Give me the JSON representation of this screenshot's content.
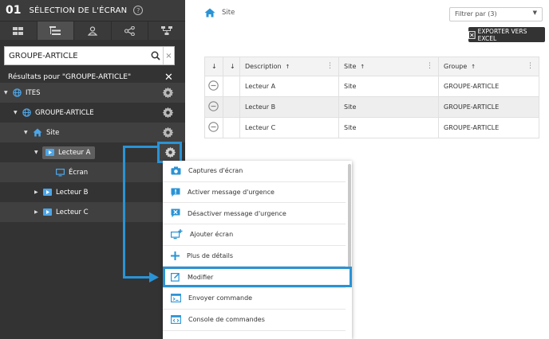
{
  "panel": {
    "step_number": "01",
    "title": "SÉLECTION DE L'ÉCRAN",
    "help": "?",
    "toolbar": [
      "grid-view-icon",
      "tree-view-icon",
      "user-tree-icon",
      "share-icon",
      "hierarchy-icon"
    ]
  },
  "search": {
    "value": "GROUPE-ARTICLE",
    "clear": "×"
  },
  "results": {
    "label": "Résultats pour \"GROUPE-ARTICLE\"",
    "close": "✕"
  },
  "tree": {
    "ites": "ITES",
    "groupe": "GROUPE-ARTICLE",
    "site": "Site",
    "lecteur_a": "Lecteur A",
    "ecran": "Écran",
    "lecteur_b": "Lecteur B",
    "lecteur_c": "Lecteur C"
  },
  "breadcrumb": {
    "label": "Site"
  },
  "filter": {
    "value": "Filtrer par (3)"
  },
  "export": {
    "label": "EXPORTER VERS EXCEL"
  },
  "table": {
    "headers": [
      "Description",
      "Site",
      "Groupe"
    ],
    "rows": [
      {
        "description": "Lecteur A",
        "site": "Site",
        "groupe": "GROUPE-ARTICLE"
      },
      {
        "description": "Lecteur B",
        "site": "Site",
        "groupe": "GROUPE-ARTICLE"
      },
      {
        "description": "Lecteur C",
        "site": "Site",
        "groupe": "GROUPE-ARTICLE"
      }
    ]
  },
  "menu": {
    "items": [
      "Captures d'écran",
      "Activer message d'urgence",
      "Désactiver message d'urgence",
      "Ajouter écran",
      "Plus de détails",
      "Modifier",
      "Envoyer commande",
      "Console de commandes"
    ]
  },
  "colors": {
    "accent": "#2a93d5",
    "panel_bg": "#333333",
    "tree_icon": "#4da6e8"
  }
}
